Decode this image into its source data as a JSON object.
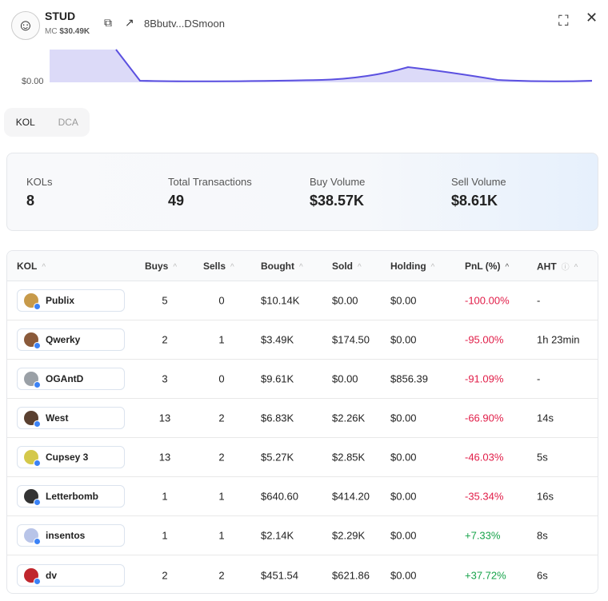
{
  "token": {
    "symbol": "STUD",
    "mc_label": "MC",
    "mc_value": "$30.49K",
    "address": "8Bbutv...DSmoon"
  },
  "chart": {
    "y_label": "$0.00",
    "line_color": "#5b50e0",
    "fill_color": "#dcdaf8"
  },
  "tabs": [
    {
      "label": "KOL",
      "active": true
    },
    {
      "label": "DCA",
      "active": false
    }
  ],
  "stats": [
    {
      "label": "KOLs",
      "value": "8"
    },
    {
      "label": "Total Transactions",
      "value": "49"
    },
    {
      "label": "Buy Volume",
      "value": "$38.57K"
    },
    {
      "label": "Sell Volume",
      "value": "$8.61K"
    }
  ],
  "table": {
    "headers": [
      "KOL",
      "Buys",
      "Sells",
      "Bought",
      "Sold",
      "Holding",
      "PnL (%)",
      "AHT"
    ],
    "rows": [
      {
        "kol": "Publix",
        "buys": "5",
        "sells": "0",
        "bought": "$10.14K",
        "sold": "$0.00",
        "holding": "$0.00",
        "pnl": "-100.00%",
        "aht": "-",
        "avatar": "#c79a4a"
      },
      {
        "kol": "Qwerky",
        "buys": "2",
        "sells": "1",
        "bought": "$3.49K",
        "sold": "$174.50",
        "holding": "$0.00",
        "pnl": "-95.00%",
        "aht": "1h 23min",
        "avatar": "#8a5a3a"
      },
      {
        "kol": "OGAntD",
        "buys": "3",
        "sells": "0",
        "bought": "$9.61K",
        "sold": "$0.00",
        "holding": "$856.39",
        "pnl": "-91.09%",
        "aht": "-",
        "avatar": "#9aa0a6"
      },
      {
        "kol": "West",
        "buys": "13",
        "sells": "2",
        "bought": "$6.83K",
        "sold": "$2.26K",
        "holding": "$0.00",
        "pnl": "-66.90%",
        "aht": "14s",
        "avatar": "#5a4030"
      },
      {
        "kol": "Cupsey 3",
        "buys": "13",
        "sells": "2",
        "bought": "$5.27K",
        "sold": "$2.85K",
        "holding": "$0.00",
        "pnl": "-46.03%",
        "aht": "5s",
        "avatar": "#d4c84a"
      },
      {
        "kol": "Letterbomb",
        "buys": "1",
        "sells": "1",
        "bought": "$640.60",
        "sold": "$414.20",
        "holding": "$0.00",
        "pnl": "-35.34%",
        "aht": "16s",
        "avatar": "#333333"
      },
      {
        "kol": "insentos",
        "buys": "1",
        "sells": "1",
        "bought": "$2.14K",
        "sold": "$2.29K",
        "holding": "$0.00",
        "pnl": "+7.33%",
        "aht": "8s",
        "avatar": "#b8c4e8"
      },
      {
        "kol": "dv",
        "buys": "2",
        "sells": "2",
        "bought": "$451.54",
        "sold": "$621.86",
        "holding": "$0.00",
        "pnl": "+37.72%",
        "aht": "6s",
        "avatar": "#c0262d"
      }
    ]
  }
}
